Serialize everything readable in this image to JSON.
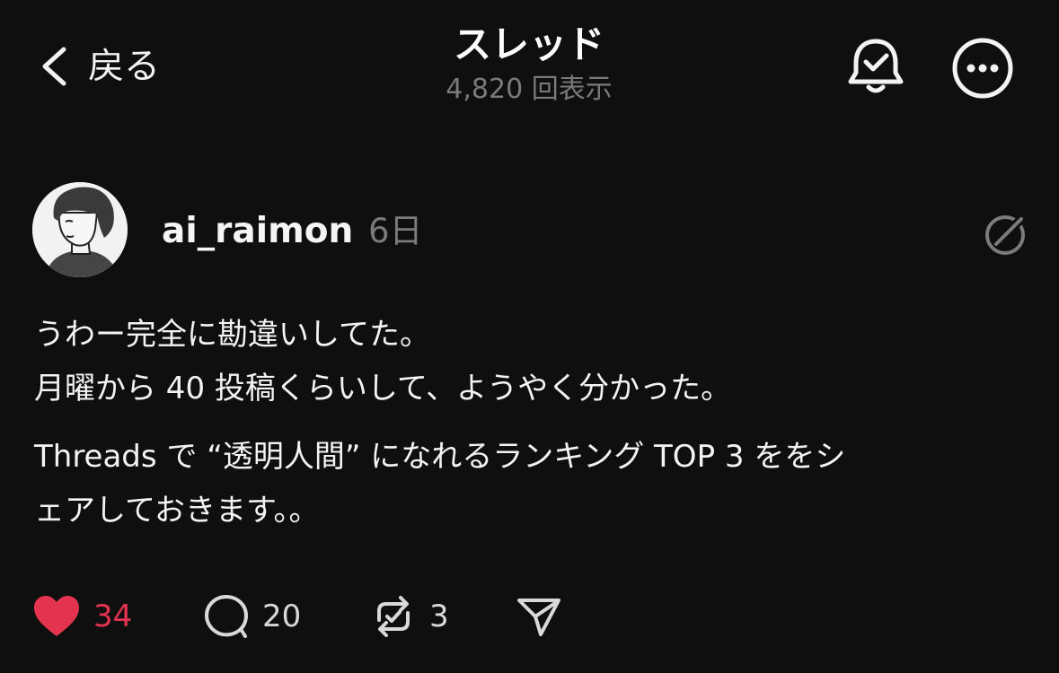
{
  "header": {
    "back_label": "戻る",
    "title": "スレッド",
    "views": "4,820 回表示"
  },
  "post": {
    "username": "ai_raimon",
    "time": "6日",
    "body": [
      "うわー完全に勘違いしてた。",
      "月曜から 40 投稿くらいして、ようやく分かった。",
      "Threads で “透明人間” になれるランキング TOP 3 ををシ",
      "ェアしておきます。。"
    ]
  },
  "actions": {
    "likes": "34",
    "replies": "20",
    "reposts": "3"
  },
  "colors": {
    "background": "#0f0f0f",
    "like": "#e3334f",
    "muted": "#7a7a7a"
  },
  "icons": {
    "back": "chevron-left-icon",
    "bell": "bell-check-icon",
    "more": "more-horizontal-circle-icon",
    "translate": "translate-icon",
    "like": "heart-icon",
    "reply": "comment-icon",
    "repost": "repost-icon",
    "share": "send-icon"
  }
}
